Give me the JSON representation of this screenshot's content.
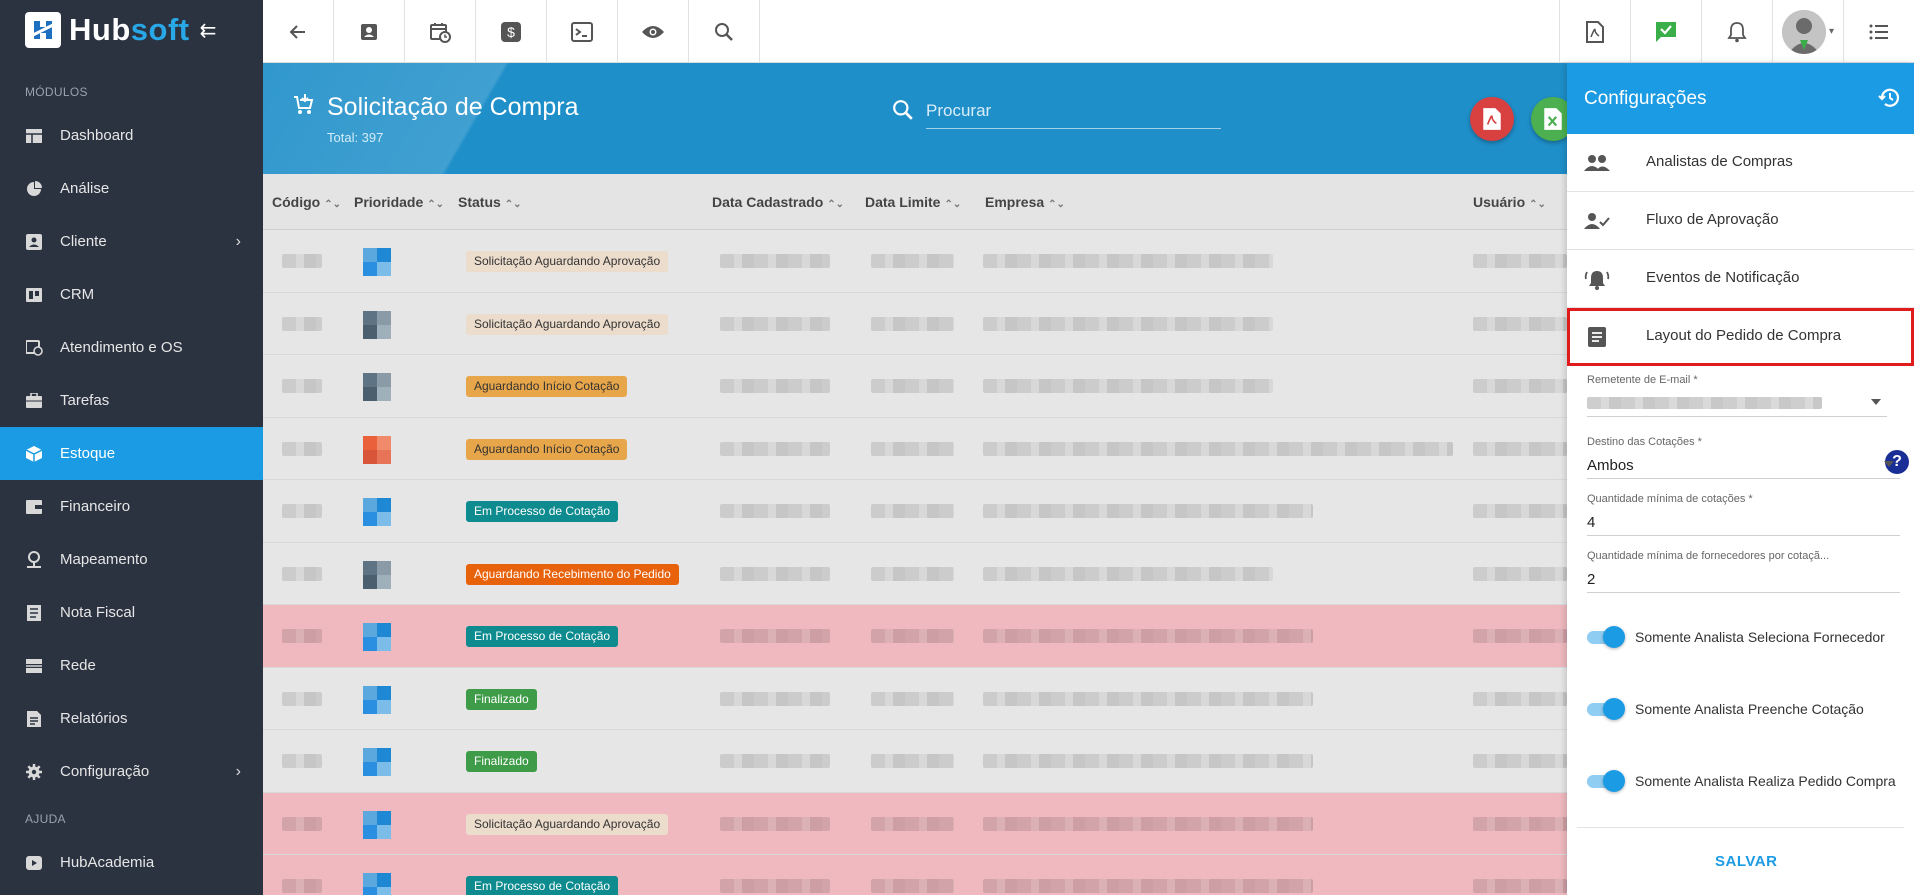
{
  "brand": {
    "name_part1": "Hub",
    "name_part2": "soft"
  },
  "sidebar": {
    "section_modules": "MÓDULOS",
    "section_help": "AJUDA",
    "items": [
      {
        "label": "Dashboard",
        "icon": "dashboard-icon"
      },
      {
        "label": "Análise",
        "icon": "pie-chart-icon"
      },
      {
        "label": "Cliente",
        "icon": "contact-card-icon",
        "has_children": true
      },
      {
        "label": "CRM",
        "icon": "crm-board-icon"
      },
      {
        "label": "Atendimento e OS",
        "icon": "calendar-clock-icon"
      },
      {
        "label": "Tarefas",
        "icon": "briefcase-icon"
      },
      {
        "label": "Estoque",
        "icon": "box-icon",
        "active": true
      },
      {
        "label": "Financeiro",
        "icon": "wallet-icon"
      },
      {
        "label": "Mapeamento",
        "icon": "map-pin-icon"
      },
      {
        "label": "Nota Fiscal",
        "icon": "receipt-icon"
      },
      {
        "label": "Rede",
        "icon": "server-icon"
      },
      {
        "label": "Relatórios",
        "icon": "report-icon"
      },
      {
        "label": "Configuração",
        "icon": "gear-icon",
        "has_children": true
      }
    ],
    "help_items": [
      {
        "label": "HubAcademia",
        "icon": "video-play-icon"
      }
    ]
  },
  "topbar": {
    "buttons": [
      "back-arrow-icon",
      "contact-icon",
      "calendar-clock-icon",
      "dollar-icon",
      "terminal-icon",
      "eye-icon",
      "search-icon"
    ],
    "right_buttons": [
      "pdf-icon",
      "chat-check-icon",
      "bell-icon",
      "avatar"
    ]
  },
  "page": {
    "title": "Solicitação de Compra",
    "total": "Total: 397",
    "search_placeholder": "Procurar"
  },
  "table": {
    "columns": [
      "Código",
      "Prioridade",
      "Status",
      "Data Cadastrado",
      "Data Limite",
      "Empresa",
      "Usuário"
    ],
    "rows": [
      {
        "status": "Solicitação Aguardando Aprovação",
        "style": "aguard",
        "highlight": "grey",
        "priority": "blue"
      },
      {
        "status": "Solicitação Aguardando Aprovação",
        "style": "aguard",
        "highlight": "grey",
        "priority": "slate"
      },
      {
        "status": "Aguardando Início Cotação",
        "style": "inicio",
        "highlight": "grey",
        "priority": "slate"
      },
      {
        "status": "Aguardando Início Cotação",
        "style": "inicio",
        "highlight": "grey",
        "priority": "orange"
      },
      {
        "status": "Em Processo de Cotação",
        "style": "processo",
        "highlight": "grey",
        "priority": "blue"
      },
      {
        "status": "Aguardando Recebimento do Pedido",
        "style": "receb",
        "highlight": "grey",
        "priority": "slate"
      },
      {
        "status": "Em Processo de Cotação",
        "style": "processo",
        "highlight": "pink",
        "priority": "blue"
      },
      {
        "status": "Finalizado",
        "style": "final",
        "highlight": "grey",
        "priority": "blue"
      },
      {
        "status": "Finalizado",
        "style": "final",
        "highlight": "grey",
        "priority": "blue"
      },
      {
        "status": "Solicitação Aguardando Aprovação",
        "style": "aguard",
        "highlight": "pink",
        "priority": "blue"
      },
      {
        "status": "Em Processo de Cotação",
        "style": "processo",
        "highlight": "pink",
        "priority": "blue"
      }
    ]
  },
  "panel": {
    "title": "Configurações",
    "items": [
      {
        "label": "Analistas de Compras",
        "icon": "people-icon"
      },
      {
        "label": "Fluxo de Aprovação",
        "icon": "person-check-icon"
      },
      {
        "label": "Eventos de Notificação",
        "icon": "alarm-bell-icon"
      },
      {
        "label": "Layout do Pedido de Compra",
        "icon": "document-icon",
        "selected": true
      }
    ],
    "fields": {
      "remetente_label": "Remetente de E-mail *",
      "destino_label": "Destino das Cotações *",
      "destino_value": "Ambos",
      "qtd_cotacoes_label": "Quantidade mínima de cotações *",
      "qtd_cotacoes_value": "4",
      "qtd_fornecedores_label": "Quantidade mínima de fornecedores por cotaçã...",
      "qtd_fornecedores_value": "2"
    },
    "toggles": [
      {
        "label": "Somente Analista Seleciona Fornecedor",
        "on": true
      },
      {
        "label": "Somente Analista Preenche Cotação",
        "on": true
      },
      {
        "label": "Somente Analista Realiza Pedido Compra",
        "on": true
      }
    ],
    "save_label": "SALVAR"
  },
  "colors": {
    "sidebar_bg": "#2b3240",
    "accent": "#1b9be3",
    "header_bg": "#1f8fc9",
    "highlight_outline": "#e01b1b"
  }
}
